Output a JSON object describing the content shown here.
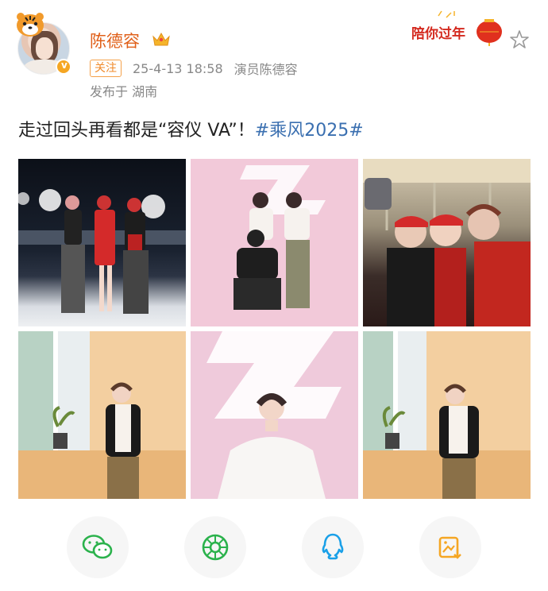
{
  "header": {
    "username": "陈德容",
    "follow_label": "关注",
    "timestamp": "25-4-13 18:58",
    "source": "演员陈德容",
    "location": "发布于 湖南",
    "festival_badge": "陪你过年"
  },
  "post": {
    "text": "走过回头再看都是“容仪 VA”！",
    "hashtag": "#乘风2025#"
  },
  "photos": [
    {
      "name": "stage-group-photo"
    },
    {
      "name": "pink-backdrop-group-photo"
    },
    {
      "name": "selfie-group-photo"
    },
    {
      "name": "window-solo-photo-1"
    },
    {
      "name": "pink-backdrop-solo-photo"
    },
    {
      "name": "window-solo-photo-2"
    }
  ],
  "share": {
    "items": [
      "wechat",
      "moments",
      "qq",
      "save-image"
    ]
  },
  "colors": {
    "username": "#e0601a",
    "hashtag": "#3a6fb0",
    "follow_border": "#f5a14a",
    "festival": "#d42a1f"
  }
}
